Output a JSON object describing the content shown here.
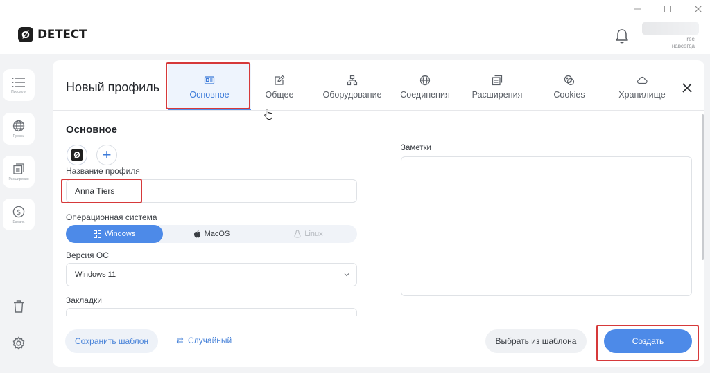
{
  "app": {
    "logo_mark": "Ø",
    "logo_text": "DETECT",
    "window_controls": [
      "minimize-icon",
      "maximize-icon",
      "close-icon"
    ],
    "plan_line1": "Free",
    "plan_line2": "навсегда"
  },
  "sidebar": {
    "items": [
      {
        "label": "Профили",
        "icon": "list-icon"
      },
      {
        "label": "Прокси",
        "icon": "globe-icon"
      },
      {
        "label": "Расширения",
        "icon": "extension-icon"
      },
      {
        "label": "Баланс",
        "icon": "dollar-icon"
      }
    ],
    "bottom": [
      "trash-icon",
      "gear-icon"
    ]
  },
  "modal": {
    "title": "Новый профиль",
    "tabs": [
      {
        "label": "Основное",
        "icon": "id-card-icon",
        "active": true
      },
      {
        "label": "Общее",
        "icon": "edit-icon",
        "active": false
      },
      {
        "label": "Оборудование",
        "icon": "hierarchy-icon",
        "active": false
      },
      {
        "label": "Соединения",
        "icon": "globe-icon",
        "active": false
      },
      {
        "label": "Расширения",
        "icon": "extension-icon",
        "active": false
      },
      {
        "label": "Cookies",
        "icon": "cookie-icon",
        "active": false
      },
      {
        "label": "Хранилище",
        "icon": "cloud-icon",
        "active": false
      }
    ],
    "section_title": "Основное",
    "profile_logo_mark": "Ø",
    "add_logo": "+",
    "profile_name_label": "Название профиля",
    "profile_name_value": "Anna Tiers",
    "os_label": "Операционная система",
    "os_options": [
      {
        "label": "Windows",
        "icon": "windows-icon",
        "active": true
      },
      {
        "label": "MacOS",
        "icon": "apple-icon",
        "active": false
      },
      {
        "label": "Linux",
        "icon": "linux-icon",
        "active": false
      }
    ],
    "os_version_label": "Версия ОС",
    "os_version_value": "Windows 11",
    "bookmarks_label": "Закладки",
    "notes_label": "Заметки",
    "save_template": "Сохранить шаблон",
    "random": "Случайный",
    "choose_template": "Выбрать из шаблона",
    "create": "Создать"
  },
  "colors": {
    "accent": "#4d8ae8",
    "highlight": "#d6393a"
  }
}
